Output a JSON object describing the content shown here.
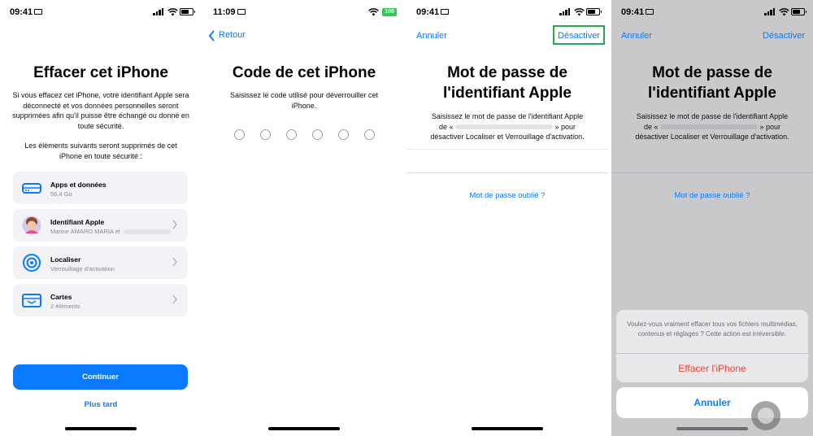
{
  "screen1": {
    "time": "09:41",
    "title": "Effacer cet iPhone",
    "intro": "Si vous effacez cet iPhone, votre identifiant Apple sera déconnecté et vos données personnelles seront supprimées afin qu'il puisse être échangé ou donné en toute sécurité.",
    "list_intro": "Les éléments suivants seront supprimés de cet iPhone en toute sécurité :",
    "items": [
      {
        "title": "Apps et données",
        "subtitle": "56,4 Go",
        "icon": "storage-icon"
      },
      {
        "title": "Identifiant Apple",
        "subtitle": "Marine AMARO MARIA et",
        "icon": "avatar"
      },
      {
        "title": "Localiser",
        "subtitle": "Verrouillage d'activation",
        "icon": "find-my-icon"
      },
      {
        "title": "Cartes",
        "subtitle": "2 éléments",
        "icon": "wallet-card-icon"
      }
    ],
    "continue_label": "Continuer",
    "later_label": "Plus tard"
  },
  "screen2": {
    "time": "11:09",
    "battery": "100",
    "back_label": "Retour",
    "title": "Code de cet iPhone",
    "instruction": "Saisissez le code utilisé pour déverrouiller cet iPhone.",
    "digits": 6
  },
  "screen3": {
    "time": "09:41",
    "cancel_label": "Annuler",
    "deactivate_label": "Désactiver",
    "title_line1": "Mot de passe de",
    "title_line2": "l'identifiant Apple",
    "desc_line1": "Saisissez le mot de passe de l'identifiant Apple",
    "desc_prefix": "de «",
    "desc_suffix": "» pour",
    "desc_line3": "désactiver Localiser et Verrouillage d'activation.",
    "forgot_label": "Mot de passe oublié ?"
  },
  "screen4": {
    "time": "09:41",
    "cancel_label": "Annuler",
    "deactivate_label": "Désactiver",
    "title_line1": "Mot de passe de",
    "title_line2": "l'identifiant Apple",
    "desc_line1": "Saisissez le mot de passe de l'identifiant Apple",
    "desc_prefix": "de «",
    "desc_suffix": "» pour",
    "desc_line3": "désactiver Localiser et Verrouillage d'activation.",
    "forgot_label": "Mot de passe oublié ?",
    "alert_message": "Voulez-vous vraiment effacer tous vos fichiers multimédias, contenus et réglages ? Cette action est irréversible.",
    "erase_label": "Effacer l'iPhone",
    "sheet_cancel_label": "Annuler"
  },
  "colors": {
    "accent": "#0a7aff",
    "destructive": "#ff3b30",
    "highlight": "#2aa74f",
    "battery_green": "#34c759"
  }
}
